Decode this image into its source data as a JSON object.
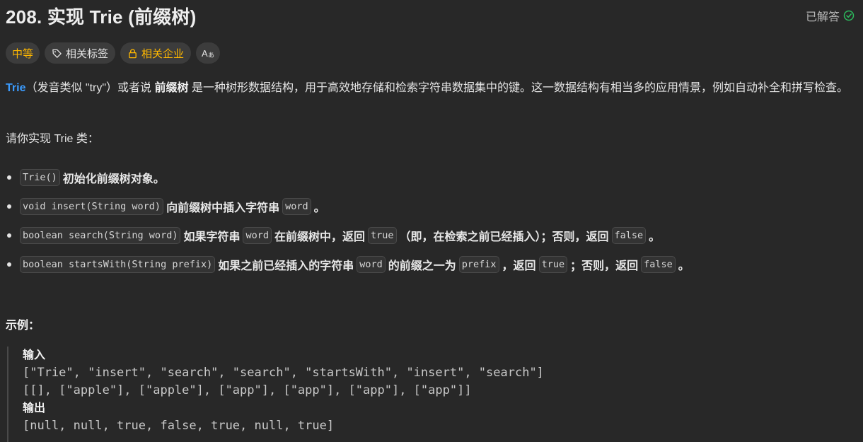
{
  "problem": {
    "title": "208. 实现 Trie (前缀树)",
    "status": "已解答",
    "status_color": "#2cbb5d"
  },
  "tags": {
    "difficulty": "中等",
    "difficulty_color": "#ffb800",
    "topics": "相关标签",
    "companies": "相关企业",
    "translate": "Aあ"
  },
  "description": {
    "trie_link": "Trie",
    "part1": "（发音类似 \"try\"）或者说 ",
    "prefix_tree": "前缀树",
    "part2": " 是一种树形数据结构，用于高效地存储和检索字符串数据集中的键。这一数据结构有相当多的应用情景，例如自动补全和拼写检查。",
    "intro": "请你实现 Trie 类："
  },
  "methods": [
    {
      "code": "Trie()",
      "text": "初始化前缀树对象。"
    },
    {
      "code": "void insert(String word)",
      "text1": "向前缀树中插入字符串",
      "code2": "word",
      "text2": "。"
    },
    {
      "code": "boolean search(String word)",
      "text1": "如果字符串",
      "code2": "word",
      "text2": "在前缀树中，返回",
      "code3": "true",
      "text3": "（即，在检索之前已经插入）；否则，返回",
      "code4": "false",
      "text4": "。"
    },
    {
      "code": "boolean startsWith(String prefix)",
      "text1": "如果之前已经插入的字符串",
      "code2": "word",
      "text2": "的前缀之一为",
      "code3": "prefix",
      "text3": "，返回",
      "code4": "true",
      "text4": "；否则，返回",
      "code5": "false",
      "text5": "。"
    }
  ],
  "example": {
    "title": "示例：",
    "input_label": "输入",
    "input_line1": "[\"Trie\", \"insert\", \"search\", \"search\", \"startsWith\", \"insert\", \"search\"]",
    "input_line2": "[[], [\"apple\"], [\"apple\"], [\"app\"], [\"app\"], [\"app\"], [\"app\"]]",
    "output_label": "输出",
    "output_line": "[null, null, true, false, true, null, true]"
  },
  "icons": {
    "solved": "check-circle-icon",
    "tag": "tag-icon",
    "lock": "lock-icon",
    "translate": "translate-icon"
  }
}
